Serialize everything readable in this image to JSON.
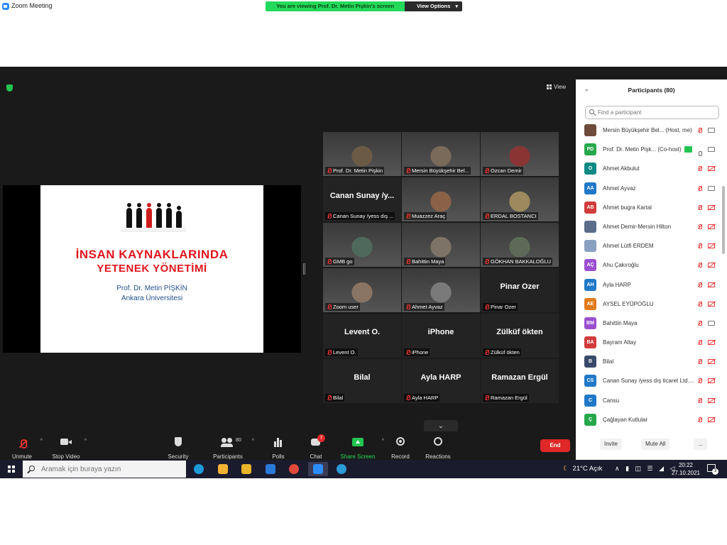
{
  "window": {
    "title": "Zoom Meeting",
    "share_banner": "You are viewing Prof. Dr. Metin Pişkin's screen",
    "view_options": "View Options",
    "view_options_caret": "▾",
    "controls": {
      "minimize": "—",
      "maximize": "❐",
      "close": "✕"
    }
  },
  "meeting": {
    "view_label": "View",
    "slide": {
      "title_line1": "İNSAN KAYNAKLARINDA",
      "title_line2": "YETENEK YÖNETİMİ",
      "author": "Prof. Dr. Metin PİŞKİN",
      "institution": "Ankara Üniversitesi"
    },
    "gallery": [
      {
        "name": "Prof. Dr. Metin Pişkin",
        "big": "",
        "video": true,
        "active": true,
        "tone": "#6b5b45"
      },
      {
        "name": "Mersin Büyükşehir Bel...",
        "big": "",
        "video": true,
        "active": false,
        "tone": "#7a6a5a"
      },
      {
        "name": "Ozcan Demir",
        "big": "",
        "video": true,
        "active": false,
        "tone": "#8a3434"
      },
      {
        "name": "Canan Sunay /yess dış ...",
        "big": "Canan Sunay /y...",
        "video": false,
        "active": false
      },
      {
        "name": "Muazzez Araç",
        "big": "",
        "video": true,
        "active": false,
        "tone": "#8a6248"
      },
      {
        "name": "ERDAL BOSTANCI",
        "big": "",
        "video": true,
        "active": false,
        "tone": "#9c8a5e"
      },
      {
        "name": "GMB go",
        "big": "",
        "video": true,
        "active": false,
        "tone": "#4f6a5c"
      },
      {
        "name": "Bahittin Maya",
        "big": "",
        "video": true,
        "active": false,
        "tone": "#7d7367"
      },
      {
        "name": "GÖKHAN BAKKALOĞLU",
        "big": "",
        "video": true,
        "active": false,
        "tone": "#5d6a58"
      },
      {
        "name": "Zoom user",
        "big": "",
        "video": true,
        "active": false,
        "tone": "#8a7565"
      },
      {
        "name": "Ahmet Ayvaz",
        "big": "",
        "video": true,
        "active": false,
        "tone": "#7a7a7a"
      },
      {
        "name": "Pinar Ozer",
        "big": "Pinar Ozer",
        "video": false,
        "active": false
      },
      {
        "name": "Levent O.",
        "big": "Levent O.",
        "video": false,
        "active": false
      },
      {
        "name": "iPhone",
        "big": "iPhone",
        "video": false,
        "active": false
      },
      {
        "name": "Zülküf ökten",
        "big": "Zülküf ökten",
        "video": false,
        "active": false
      },
      {
        "name": "Bilal",
        "big": "Bilal",
        "video": false,
        "active": false
      },
      {
        "name": "Ayla HARP",
        "big": "Ayla HARP",
        "video": false,
        "active": false
      },
      {
        "name": "Ramazan Ergül",
        "big": "Ramazan Ergül",
        "video": false,
        "active": false
      }
    ],
    "gallery_down": "⌄"
  },
  "toolbar": {
    "unmute": "Unmute",
    "stop_video": "Stop Video",
    "security": "Security",
    "participants": "Participants",
    "participants_count": "80",
    "polls": "Polls",
    "chat": "Chat",
    "chat_badge": "7",
    "share_screen": "Share Screen",
    "record": "Record",
    "reactions": "Reactions",
    "end": "End",
    "caret": "^"
  },
  "panel": {
    "title": "Participants (80)",
    "collapse": "⌄",
    "search_placeholder": "Find a participant",
    "participants": [
      {
        "initials": "",
        "name": "Mersin Büyükşehir Bel... (Host, me)",
        "color": "#6e4b3a",
        "mic": "off",
        "cam": "on"
      },
      {
        "initials": "PD",
        "name": "Prof. Dr. Metin Pişk... (Co-host)",
        "color": "#26a84a",
        "mic": "on",
        "cam": "on",
        "sharing": true
      },
      {
        "initials": "O",
        "name": "Ahmet Akbulut",
        "color": "#0e8a84",
        "mic": "off",
        "cam": "off"
      },
      {
        "initials": "AA",
        "name": "Ahmet Ayvaz",
        "color": "#1f78c8",
        "mic": "off",
        "cam": "on"
      },
      {
        "initials": "AB",
        "name": "Ahmet bugra Kartal",
        "color": "#d23b3b",
        "mic": "off",
        "cam": "off"
      },
      {
        "initials": "",
        "name": "Ahmet Demir-Mersin Hilton",
        "color": "#5a6e8a",
        "mic": "off",
        "cam": "off"
      },
      {
        "initials": "",
        "name": "Ahmet Lütfi ERDEM",
        "color": "#8aa0c0",
        "mic": "off",
        "cam": "off"
      },
      {
        "initials": "AÇ",
        "name": "Ahu Çakıroğlu",
        "color": "#9b4fcf",
        "mic": "off",
        "cam": "off"
      },
      {
        "initials": "AH",
        "name": "Ayla HARP",
        "color": "#1f78c8",
        "mic": "off",
        "cam": "off"
      },
      {
        "initials": "AE",
        "name": "AYSEL EYÜPOĞLU",
        "color": "#e07a1a",
        "mic": "off",
        "cam": "off"
      },
      {
        "initials": "BM",
        "name": "Bahittin Maya",
        "color": "#9b4fcf",
        "mic": "off",
        "cam": "on"
      },
      {
        "initials": "BA",
        "name": "Bayram Altay",
        "color": "#d23b3b",
        "mic": "off",
        "cam": "off"
      },
      {
        "initials": "B",
        "name": "Bilal",
        "color": "#3a4a6a",
        "mic": "off",
        "cam": "off"
      },
      {
        "initials": "CS",
        "name": "Canan Sunay /yess dış ticaret Ltd....",
        "color": "#1f78c8",
        "mic": "off",
        "cam": "off"
      },
      {
        "initials": "C",
        "name": "Cansu",
        "color": "#1f78c8",
        "mic": "off",
        "cam": "off"
      },
      {
        "initials": "Ç",
        "name": "Çağlayan Kutlular",
        "color": "#26a84a",
        "mic": "off",
        "cam": "off"
      }
    ],
    "invite": "Invite",
    "mute_all": "Mute All",
    "more": "..."
  },
  "taskbar": {
    "search_placeholder": "Aramak için buraya yazın",
    "weather_temp": "21°C",
    "weather_text": "Açık",
    "tray_icons": "∧ ▮ ◫ ☰ ◢ ◁",
    "time": "20:22",
    "date": "27.10.2021",
    "notif_count": "3",
    "apps": [
      {
        "name": "edge",
        "color": "#1d9bd8"
      },
      {
        "name": "store",
        "color": "#f2b233"
      },
      {
        "name": "file-explorer",
        "color": "#e8b42a"
      },
      {
        "name": "mail",
        "color": "#2a7ad8"
      },
      {
        "name": "chrome",
        "color": "#e04a3a"
      },
      {
        "name": "zoom",
        "color": "#2d8cff"
      },
      {
        "name": "internet-explorer",
        "color": "#2a9ad8"
      }
    ]
  }
}
